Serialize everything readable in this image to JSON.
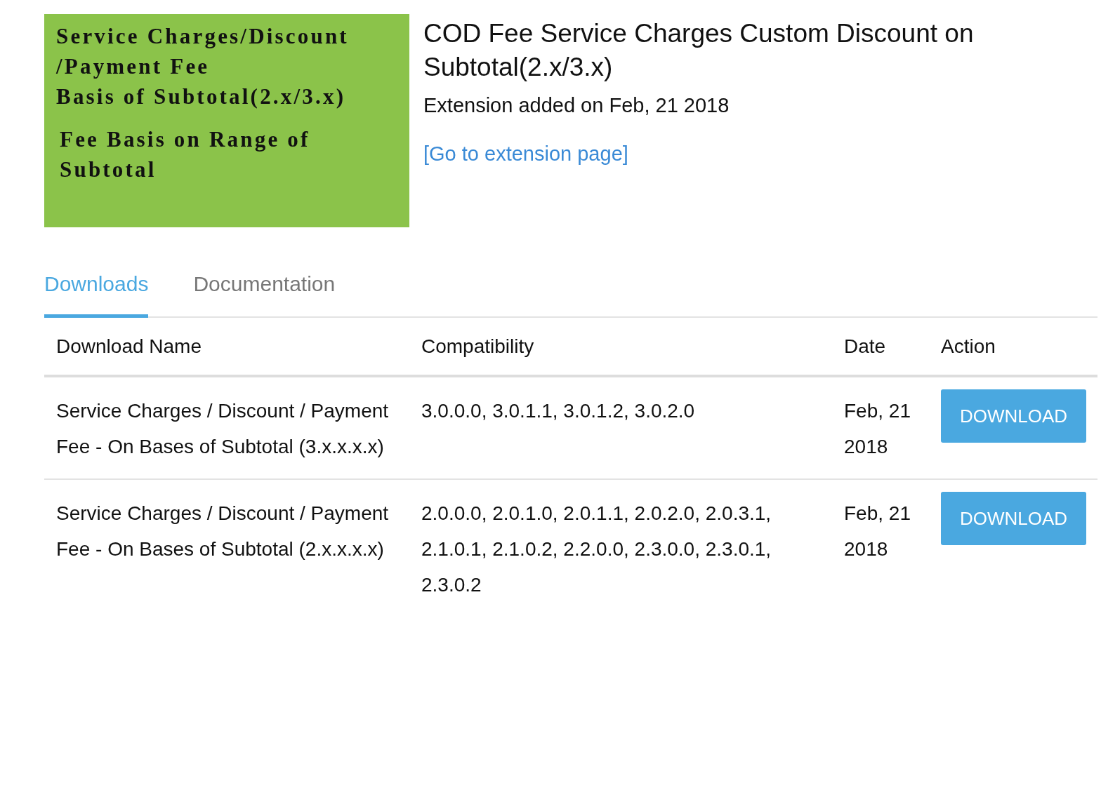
{
  "banner": {
    "blocks": [
      [
        "Service Charges/Discount",
        "/Payment Fee",
        "Basis of Subtotal(2.x/3.x)"
      ],
      [
        "Fee Basis on Range of",
        "Subtotal"
      ]
    ]
  },
  "title": "COD Fee Service Charges Custom Discount on Subtotal(2.x/3.x)",
  "added": "Extension added on Feb, 21 2018",
  "link": "[Go to extension page]",
  "tabs": [
    {
      "label": "Downloads",
      "selected": true
    },
    {
      "label": "Documentation",
      "selected": false
    }
  ],
  "table": {
    "columns": [
      "Download Name",
      "Compatibility",
      "Date",
      "Action"
    ],
    "rows": [
      {
        "name": "Service Charges / Discount / Payment Fee - On Bases of Subtotal (3.x.x.x.x)",
        "compatibility": "3.0.0.0, 3.0.1.1, 3.0.1.2, 3.0.2.0",
        "date": "Feb, 21 2018",
        "action": "DOWNLOAD"
      },
      {
        "name": "Service Charges / Discount / Payment Fee - On Bases of Subtotal (2.x.x.x.x)",
        "compatibility": "2.0.0.0, 2.0.1.0, 2.0.1.1, 2.0.2.0, 2.0.3.1, 2.1.0.1, 2.1.0.2, 2.2.0.0, 2.3.0.0, 2.3.0.1, 2.3.0.2",
        "date": "Feb, 21 2018",
        "action": "DOWNLOAD"
      }
    ]
  }
}
